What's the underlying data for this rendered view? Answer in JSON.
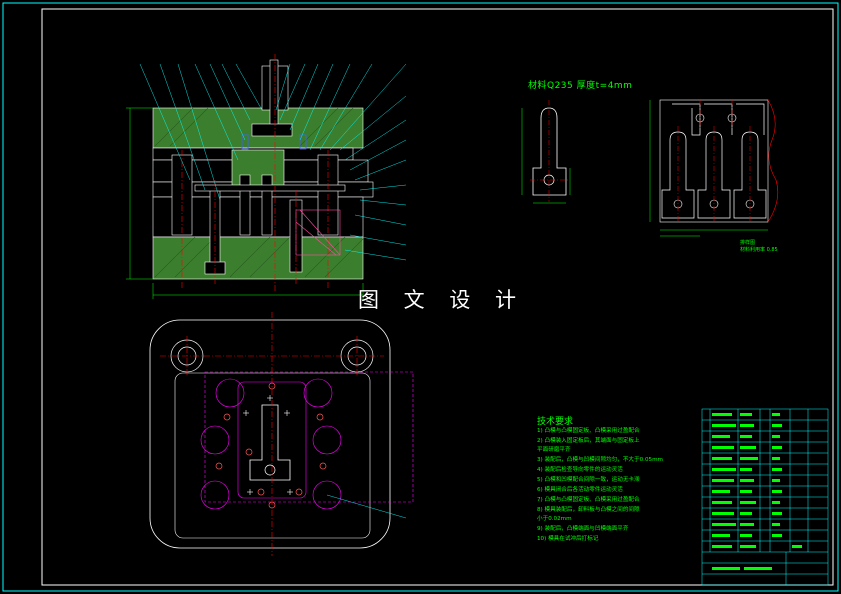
{
  "drawing": {
    "watermark": "图 文 设 计",
    "part_title": "材料Q235  厚度t=4mm",
    "layout_label": [
      "排样图",
      "材料利用率 0.85"
    ],
    "tech_title": "技术要求",
    "tech_notes": [
      "1) 凸模与凸模固定板、凸模采用过盈配合",
      "2) 凸模装入固定板后，其端面与固定板上",
      "平面研磨平齐",
      "3) 装配后，凸模与凹模间隙均匀，不大于0.05mm",
      "4) 装配后检查导向零件的运动灵活",
      "5) 凸模和凹模配合间隙一致，运动无卡滞",
      "6) 模具闭合后各活动零件运动灵活",
      "7) 凸模与凸模固定板、凸模采用过盈配合",
      "8) 模具装配后，卸料板与凸模之间的间隙",
      "小于0.02mm",
      "9) 装配后，凸模端面与凹模端面平齐",
      "10) 模具在试冲后打标记"
    ],
    "colors": {
      "background": "#000000",
      "outline": "#ffffff",
      "frame": "#00ffff",
      "leader": "#00ffff",
      "dimension": "#00ff00",
      "section": "#5faa3c",
      "centerline": "#ff0000",
      "hidden": "#ff00ff",
      "blue": "#4060ff",
      "text": "#00ff00"
    }
  }
}
